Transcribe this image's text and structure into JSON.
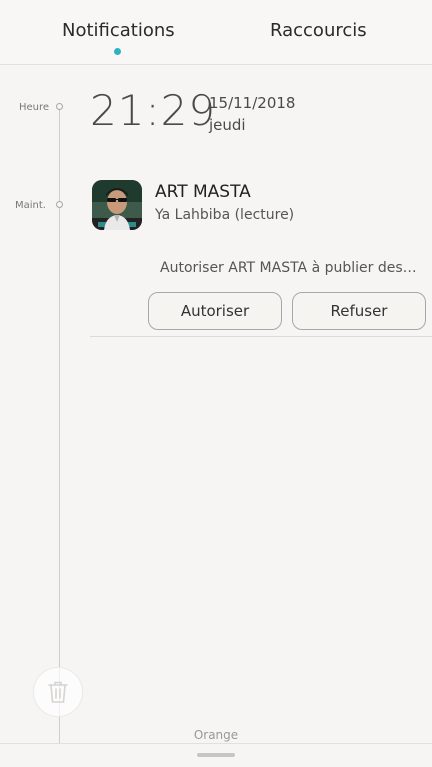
{
  "tabs": {
    "notifications_label": "Notifications",
    "shortcuts_label": "Raccourcis"
  },
  "timeline": {
    "time_label": "Heure",
    "now_label": "Maint."
  },
  "clock": {
    "time": "21:29",
    "date": "15/11/2018",
    "day": "jeudi"
  },
  "notification": {
    "app": "ART MASTA",
    "subtitle": "Ya Lahbiba (lecture)",
    "permission_prompt": "Autoriser ART MASTA à publier des…",
    "allow_label": "Autoriser",
    "deny_label": "Refuser"
  },
  "footer": {
    "carrier": "Orange"
  },
  "icons": {
    "trash": "trash-icon",
    "avatar": "avatar-image"
  },
  "colors": {
    "accent": "#2db3bf",
    "background": "#f7f5f3"
  }
}
